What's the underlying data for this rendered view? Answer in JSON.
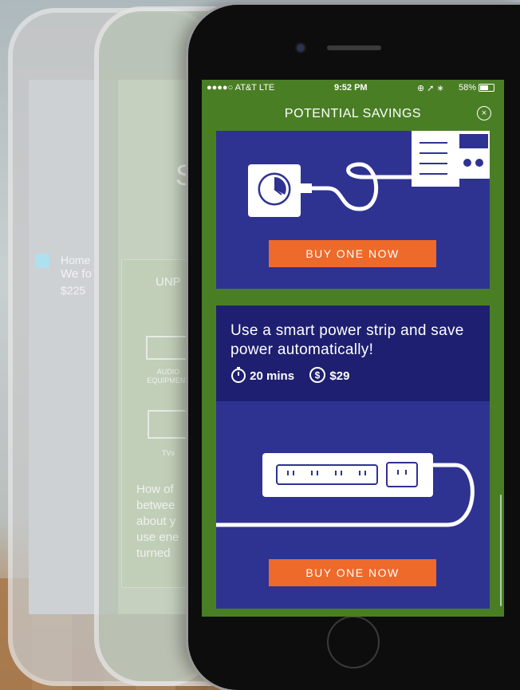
{
  "background_phones": {
    "phone1_label": "Home",
    "phone1_line2": "We fo",
    "phone1_line3": "$225",
    "phone2_heading": "S",
    "phone2_box_label": "UNP",
    "phone2_item1": "AUDIO EQUIPMENT",
    "phone2_item2": "TVs",
    "phone2_paragraph": "How of betwee about y use ene turned"
  },
  "status_bar": {
    "carrier": "●●●●○ AT&T  LTE",
    "time": "9:52 PM",
    "battery": "58%"
  },
  "nav": {
    "title": "POTENTIAL SAVINGS",
    "close_icon": "close-circle-icon"
  },
  "cards": [
    {
      "illustration": "timer-plug-illustration",
      "button_label": "BUY ONE NOW"
    },
    {
      "title": "Use a smart power strip and save power automatically!",
      "time_estimate": "20 mins",
      "cost": "$29",
      "illustration": "power-strip-illustration",
      "button_label": "BUY ONE NOW"
    }
  ],
  "colors": {
    "header_green": "#4a7e25",
    "card_blue": "#2e3392",
    "card_head_blue": "#1e1f70",
    "button_orange": "#ee6a2a"
  }
}
